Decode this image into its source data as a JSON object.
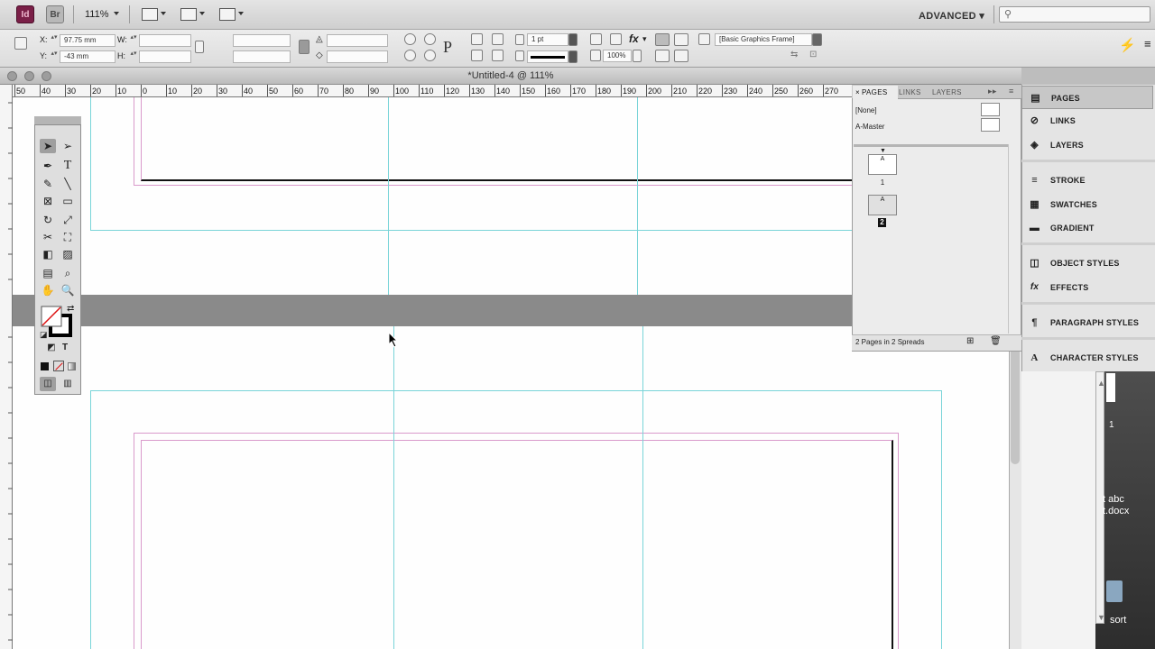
{
  "app": {
    "logo_id": "Id",
    "logo_br": "Br",
    "zoom": "111%",
    "workspace": "ADVANCED ▾"
  },
  "control": {
    "x_label": "X:",
    "x_value": "97.75 mm",
    "y_label": "Y:",
    "y_value": "-43 mm",
    "w_label": "W:",
    "h_label": "H:",
    "stroke_weight": "1 pt",
    "fitting_value": "100%",
    "object_style": "[Basic Graphics Frame]"
  },
  "document": {
    "title": "*Untitled-4 @ 111%",
    "ruler_ticks": [
      "50",
      "40",
      "30",
      "20",
      "10",
      "0",
      "10",
      "20",
      "30",
      "40",
      "50",
      "60",
      "70",
      "80",
      "90",
      "100",
      "110",
      "120",
      "130",
      "140",
      "150",
      "160",
      "170",
      "180",
      "190",
      "200",
      "210",
      "220",
      "230",
      "240",
      "250",
      "260",
      "270"
    ]
  },
  "pages_panel": {
    "tabs": [
      "PAGES",
      "LINKS",
      "LAYERS"
    ],
    "masters": [
      "[None]",
      "A-Master"
    ],
    "pages": [
      {
        "master": "A",
        "number": "1"
      },
      {
        "master": "A",
        "number": "2"
      }
    ],
    "footer": "2 Pages in 2 Spreads"
  },
  "dock": {
    "items": [
      {
        "label": "PAGES",
        "icon": "pages-icon",
        "glyph": "▤"
      },
      {
        "label": "LINKS",
        "icon": "links-icon",
        "glyph": "⊘"
      },
      {
        "label": "LAYERS",
        "icon": "layers-icon",
        "glyph": "◈"
      },
      {
        "label": "STROKE",
        "icon": "stroke-icon",
        "glyph": "≡"
      },
      {
        "label": "SWATCHES",
        "icon": "swatches-icon",
        "glyph": "▦"
      },
      {
        "label": "GRADIENT",
        "icon": "gradient-icon",
        "glyph": "▬"
      },
      {
        "label": "OBJECT STYLES",
        "icon": "object-styles-icon",
        "glyph": "◫"
      },
      {
        "label": "EFFECTS",
        "icon": "effects-icon",
        "glyph": "fx"
      },
      {
        "label": "PARAGRAPH STYLES",
        "icon": "paragraph-styles-icon",
        "glyph": "¶"
      },
      {
        "label": "CHARACTER STYLES",
        "icon": "character-styles-icon",
        "glyph": "A"
      }
    ]
  },
  "desktop": {
    "file_line1": "t abc",
    "file_line2": "t.docx",
    "number": "1",
    "sort_label": "sort"
  },
  "colors": {
    "guide": "#79d4d8",
    "margin": "#d99acb",
    "indesign_brand": "#7a1f47"
  }
}
